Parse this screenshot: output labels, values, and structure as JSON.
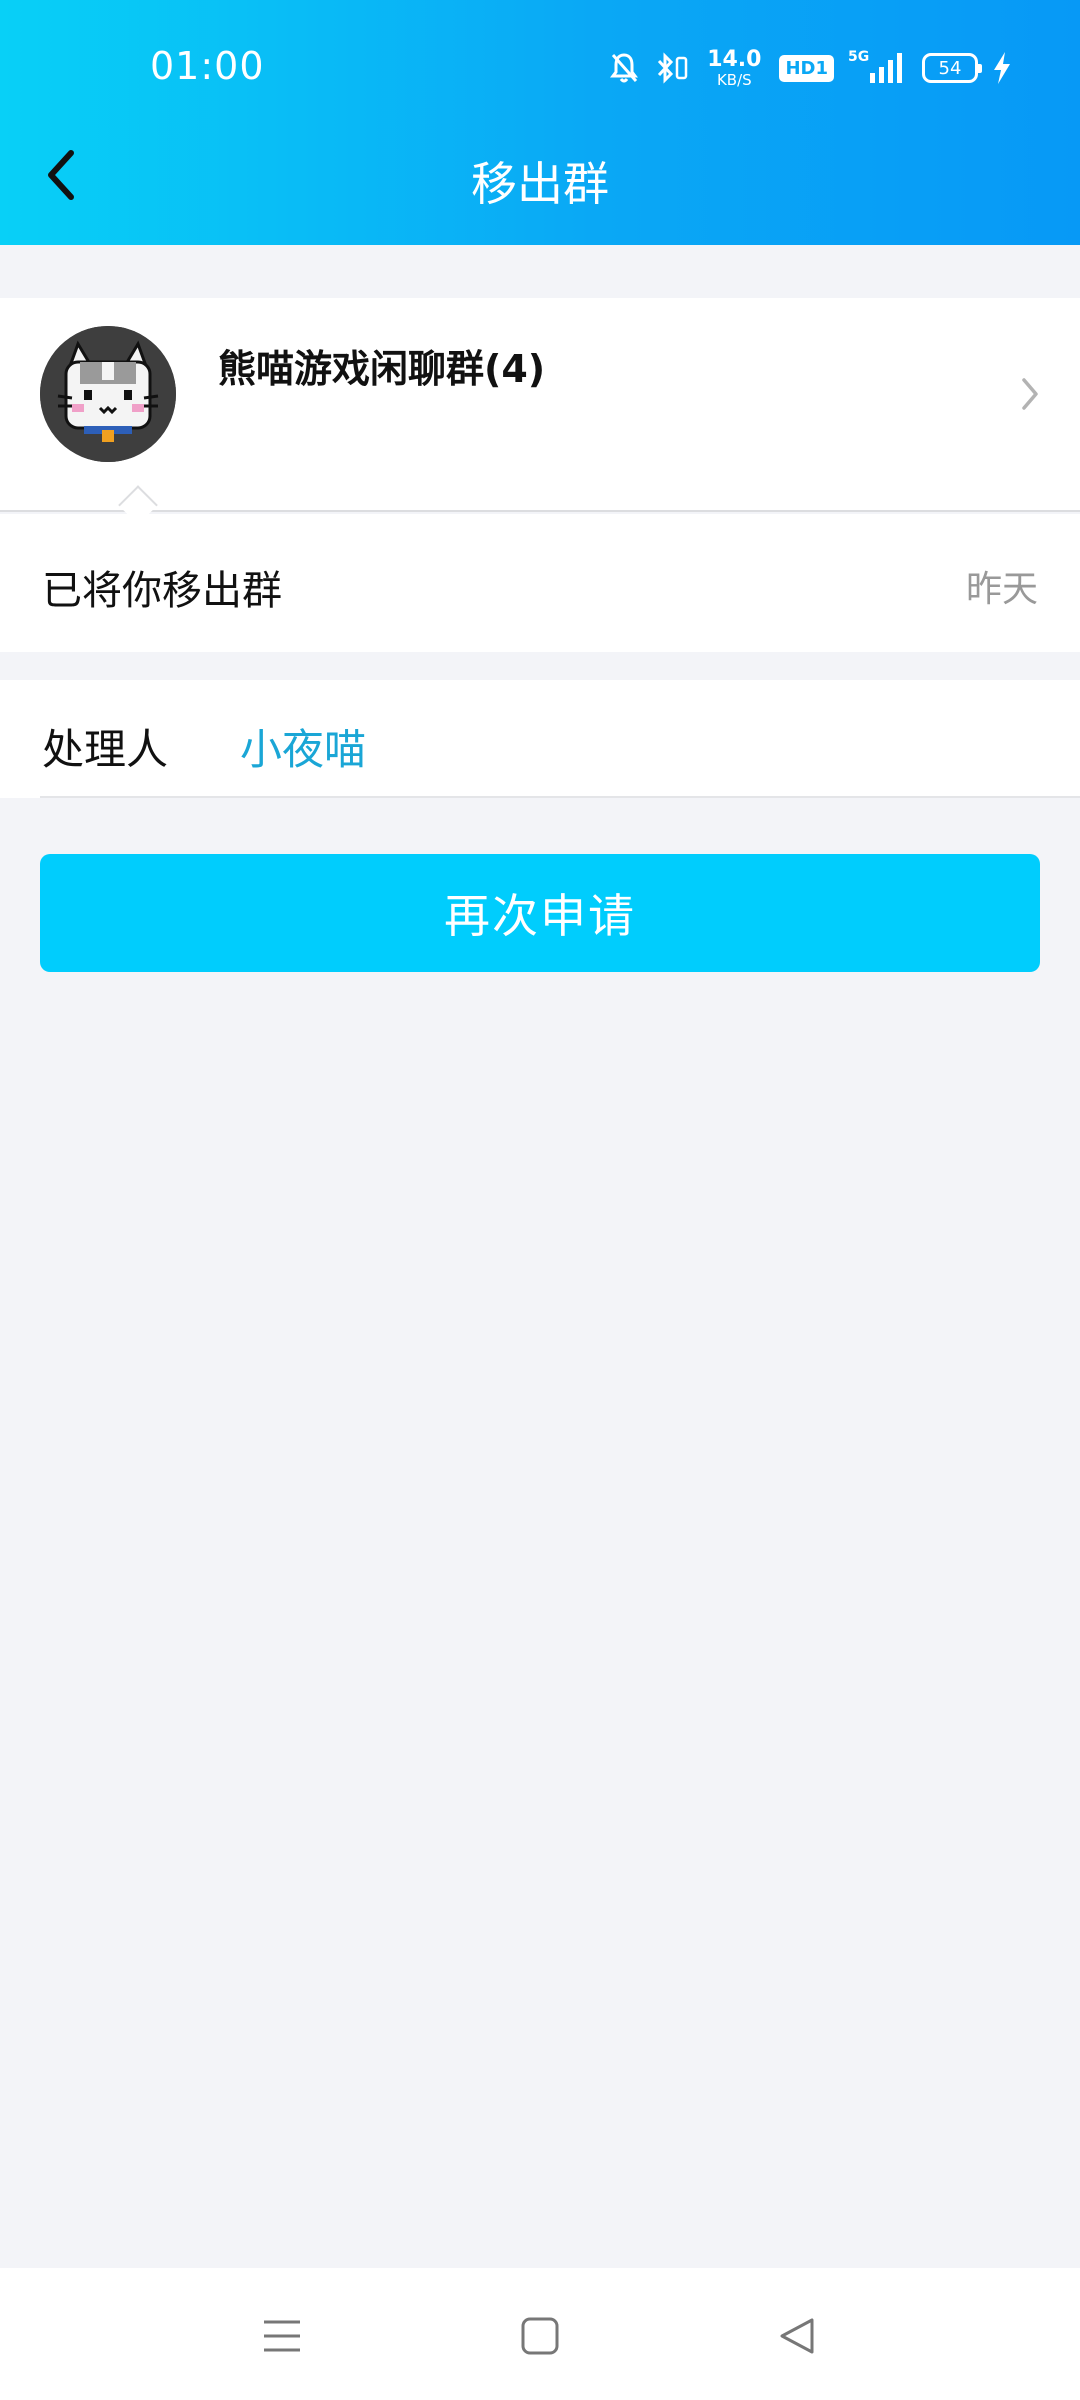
{
  "status_bar": {
    "time": "01:00",
    "net_speed_value": "14.0",
    "net_speed_unit": "KB/S",
    "hd_badge": "HD1",
    "network_label": "5G",
    "battery_level": "54"
  },
  "nav": {
    "title": "移出群"
  },
  "group": {
    "name": "熊喵游戏闲聊群(4)"
  },
  "message": {
    "text": "已将你移出群",
    "time": "昨天"
  },
  "handler": {
    "label": "处理人",
    "name": "小夜喵"
  },
  "actions": {
    "reapply_label": "再次申请"
  },
  "colors": {
    "header_gradient_start": "#08d0f7",
    "header_gradient_end": "#0799f6",
    "button_bg": "#00cdfd",
    "handler_link": "#1aa6d6",
    "page_bg": "#f3f4f8"
  }
}
